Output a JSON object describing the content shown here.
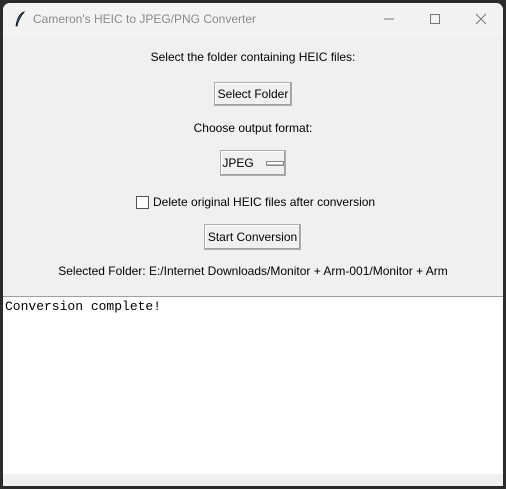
{
  "window": {
    "title": "Cameron's HEIC to JPEG/PNG Converter",
    "icon": "feather-icon"
  },
  "main": {
    "folder_prompt": "Select the folder containing HEIC files:",
    "select_folder_label": "Select Folder",
    "format_prompt": "Choose output format:",
    "format_value": "JPEG",
    "delete_checkbox_label": "Delete original HEIC files after conversion",
    "delete_checked": false,
    "start_label": "Start Conversion",
    "selected_folder": "Selected Folder: E:/Internet Downloads/Monitor + Arm-001/Monitor + Arm"
  },
  "log": {
    "text": "Conversion complete!"
  }
}
